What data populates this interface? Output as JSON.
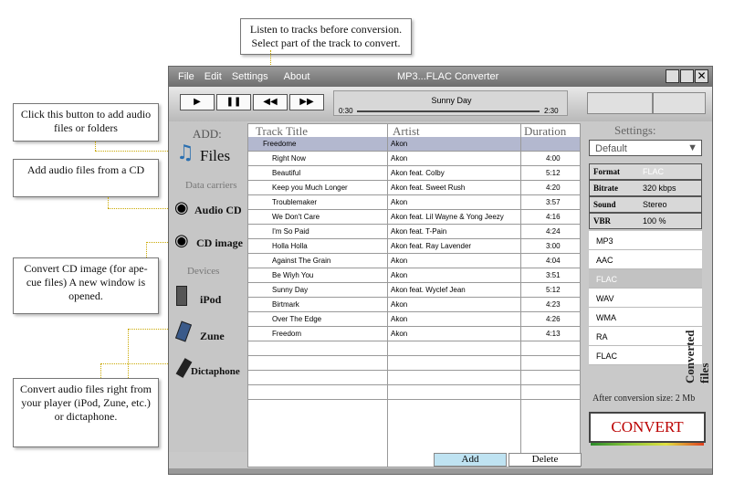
{
  "callouts": {
    "listen": "Listen to tracks before conversion. Select part of the track to convert.",
    "files": "Click this button to add audio files or folders",
    "cd": "Add audio files from a CD",
    "cdimage": "Convert CD image (for ape-cue files) A new window is opened.",
    "player": "Convert audio files right from your player (iPod, Zune, etc.) or dictaphone.",
    "converted": "Converted files"
  },
  "menu": {
    "file": "File",
    "edit": "Edit",
    "settings": "Settings",
    "about": "About",
    "title": "MP3...FLAC Converter"
  },
  "player": {
    "track": "Sunny Day",
    "start": "0:30",
    "end": "2:30",
    "play": "▶",
    "pause": "❚❚",
    "rewind": "◀◀",
    "forward": "▶▶"
  },
  "sidebar": {
    "add": "ADD:",
    "files": "Files",
    "data_carriers": "Data carriers",
    "audio_cd": "Audio CD",
    "cd_image": "CD image",
    "devices": "Devices",
    "ipod": "iPod",
    "zune": "Zune",
    "dictaphone": "Dictaphone"
  },
  "grid": {
    "col_title": "Track Title",
    "col_artist": "Artist",
    "col_duration": "Duration",
    "group_title": "Freedome",
    "group_artist": "Akon",
    "rows": [
      {
        "title": "Right Now",
        "artist": "Akon",
        "dur": "4:00"
      },
      {
        "title": "Beautiful",
        "artist": "Akon feat. Colby",
        "dur": "5:12"
      },
      {
        "title": "Keep you Much Longer",
        "artist": "Akon feat. Sweet Rush",
        "dur": "4:20"
      },
      {
        "title": "Troublemaker",
        "artist": "Akon",
        "dur": "3:57"
      },
      {
        "title": "We Don't Care",
        "artist": "Akon feat. Lil Wayne & Yong Jeezy",
        "dur": "4:16"
      },
      {
        "title": "I'm So Paid",
        "artist": "Akon feat. T-Pain",
        "dur": "4:24"
      },
      {
        "title": "Holla Holla",
        "artist": "Akon feat. Ray Lavender",
        "dur": "3:00"
      },
      {
        "title": "Against The Grain",
        "artist": "Akon",
        "dur": "4:04"
      },
      {
        "title": "Be Wiyh You",
        "artist": "Akon",
        "dur": "3:51"
      },
      {
        "title": "Sunny Day",
        "artist": "Akon feat. Wyclef Jean",
        "dur": "5:12"
      },
      {
        "title": "Birtmark",
        "artist": "Akon",
        "dur": "4:23"
      },
      {
        "title": "Over The Edge",
        "artist": "Akon",
        "dur": "4:26"
      },
      {
        "title": "Freedom",
        "artist": "Akon",
        "dur": "4:13"
      }
    ],
    "add": "Add",
    "delete": "Delete"
  },
  "settings": {
    "header": "Settings:",
    "preset": "Default",
    "format_label": "Format",
    "format_value": "FLAC",
    "bitrate_label": "Bitrate",
    "bitrate_value": "320 kbps",
    "sound_label": "Sound",
    "sound_value": "Stereo",
    "vbr_label": "VBR",
    "vbr_value": "100 %",
    "formats": [
      "MP3",
      "AAC",
      "FLAC",
      "WAV",
      "WMA",
      "RA",
      "FLAC"
    ],
    "size": "After conversion size: 2 Mb",
    "convert": "CONVERT"
  }
}
